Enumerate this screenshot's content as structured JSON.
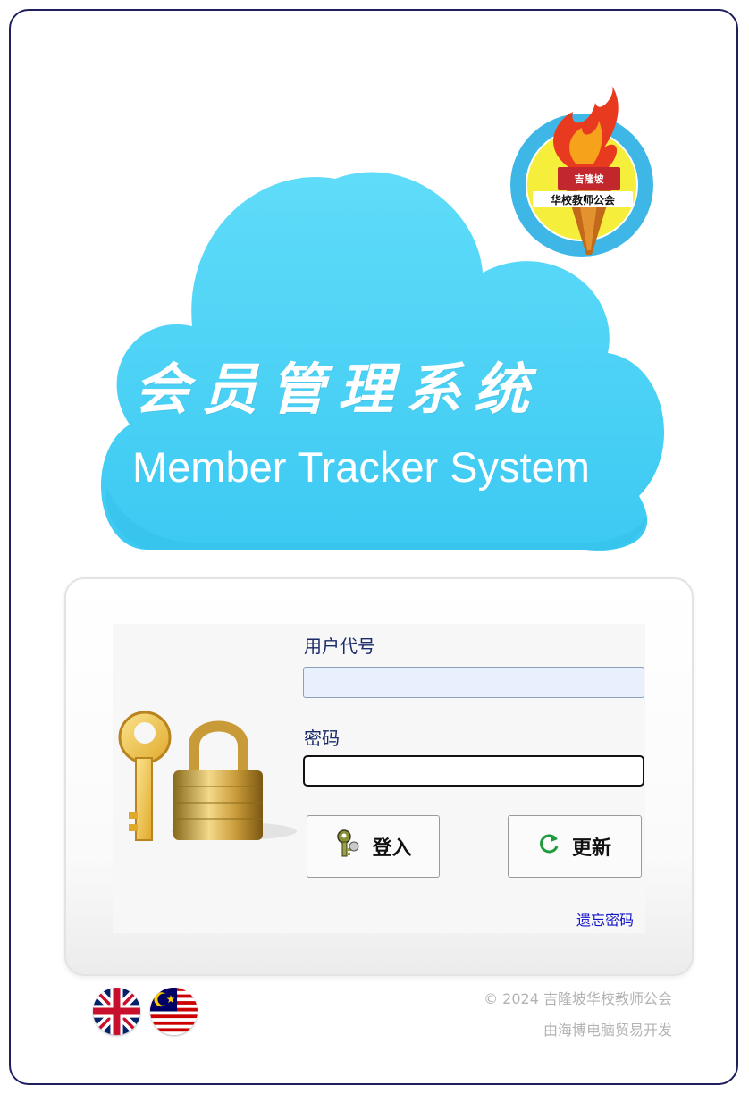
{
  "app": {
    "title_cn": "会员管理系统",
    "title_en": "Member Tracker System"
  },
  "logo": {
    "chinese_top": "吉隆坡",
    "chinese_main": "华校教师公会"
  },
  "login": {
    "username_label": "用户代号",
    "username_value": "",
    "password_label": "密码",
    "password_value": "",
    "login_button": "登入",
    "refresh_button": "更新",
    "forgot_password": "遗忘密码"
  },
  "languages": [
    {
      "name": "uk-flag-icon"
    },
    {
      "name": "malaysia-flag-icon"
    }
  ],
  "footer": {
    "copyright": "© 2024 吉隆坡华校教师公会",
    "developer": "由海博电脑贸易开发"
  },
  "colors": {
    "cloud": "#47d2f7",
    "label": "#1a2a6a",
    "link": "#1414c8",
    "frame": "#1f1f5c"
  }
}
